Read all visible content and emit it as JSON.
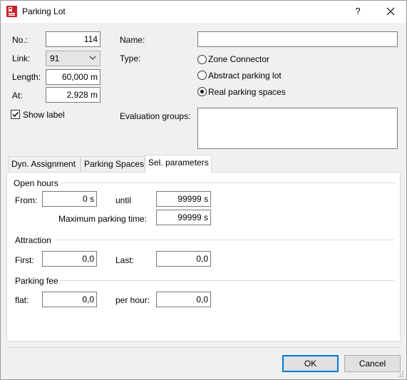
{
  "window": {
    "title": "Parking Lot",
    "help_label": "?",
    "close_label": "✕",
    "icon": "parking-lot-app-icon"
  },
  "general": {
    "no_label": "No.:",
    "no_value": "114",
    "link_label": "Link:",
    "link_value": "91",
    "length_label": "Length:",
    "length_value": "60,000 m",
    "at_label": "At:",
    "at_value": "2,928 m",
    "show_label_text": "Show label",
    "show_label_checked": true,
    "name_label": "Name:",
    "name_value": "",
    "type_label": "Type:",
    "type_options": [
      "Zone Connector",
      "Abstract parking lot",
      "Real parking spaces"
    ],
    "type_selected": "Real parking spaces",
    "evaluation_groups_label": "Evaluation groups:",
    "evaluation_groups_value": ""
  },
  "tabs": [
    "Dyn. Assignment",
    "Parking Spaces",
    "Sel. parameters"
  ],
  "active_tab": "Sel. parameters",
  "sel_parameters": {
    "open_hours_title": "Open hours",
    "from_label": "From:",
    "from_value": "0 s",
    "until_label": "until",
    "until_value": "99999 s",
    "max_parking_time_label": "Maximum parking time:",
    "max_parking_time_value": "99999 s",
    "attraction_title": "Attraction",
    "first_label": "First:",
    "first_value": "0,0",
    "last_label": "Last:",
    "last_value": "0,0",
    "parking_fee_title": "Parking fee",
    "flat_label": "flat:",
    "flat_value": "0,0",
    "per_hour_label": "per hour:",
    "per_hour_value": "0,0"
  },
  "buttons": {
    "ok_label": "OK",
    "cancel_label": "Cancel"
  },
  "colors": {
    "dialog_bg": "#f0f0f0",
    "accent": "#0078d7",
    "icon_red": "#c8202b"
  }
}
